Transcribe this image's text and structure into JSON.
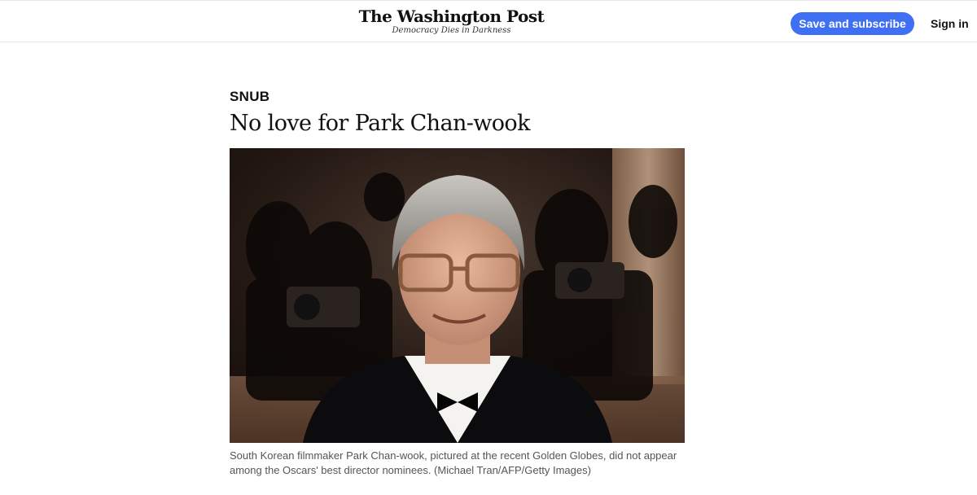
{
  "header": {
    "logo_text": "The Washington Post",
    "tagline": "Democracy Dies in Darkness",
    "subscribe_label": "Save and subscribe",
    "signin_label": "Sign in",
    "accent_color": "#3f6ff2"
  },
  "article": {
    "kicker": "SNUB",
    "headline": "No love for Park Chan-wook",
    "caption": "South Korean filmmaker Park Chan-wook, pictured at the recent Golden Globes, did not appear among the Oscars' best director nominees. (Michael Tran/AFP/Getty Images)"
  }
}
